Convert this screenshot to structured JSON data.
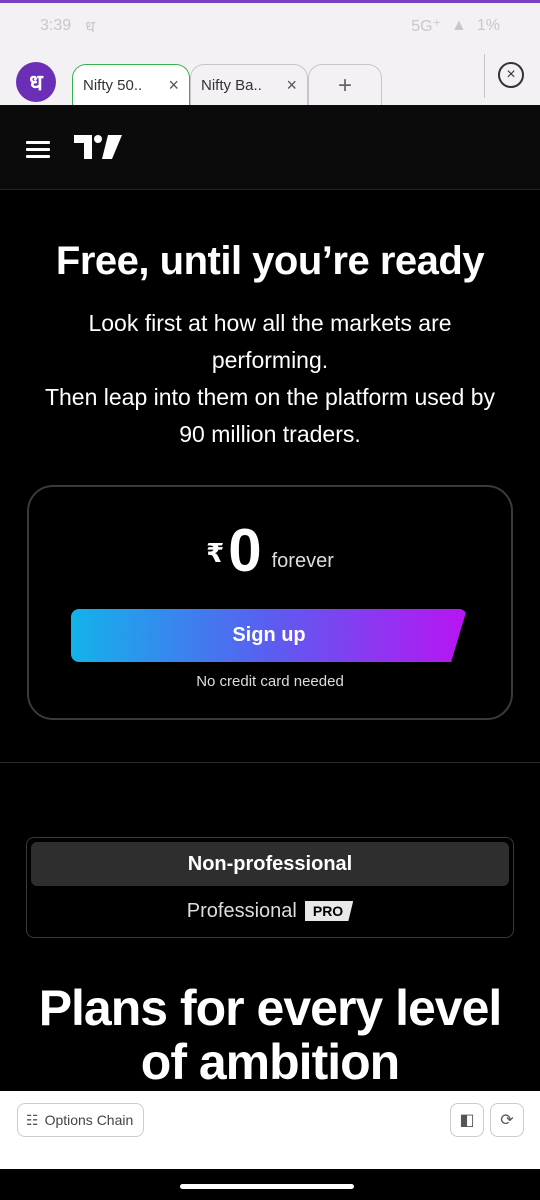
{
  "status_bar": {
    "time": "3:39",
    "left_extra": "ध",
    "network": "5G⁺",
    "battery": "1%"
  },
  "browser": {
    "logo_text": "ध",
    "tabs": [
      {
        "label": "Nifty 50..",
        "close": "×"
      },
      {
        "label": "Nifty Ba..",
        "close": "×"
      }
    ],
    "new_tab": "+",
    "close_all": "×"
  },
  "hero": {
    "title": "Free, until you’re ready",
    "line1": "Look first at how all the markets are performing.",
    "line2": "Then leap into them on the platform used by 90 million traders."
  },
  "price_card": {
    "currency": "₹",
    "amount": "0",
    "period": "forever",
    "signup_label": "Sign up",
    "note": "No credit card needed"
  },
  "plan_toggle": {
    "active_label": "Non-professional",
    "other_label": "Professional",
    "badge": "PRO"
  },
  "plans": {
    "title_line1": "Plans for every level",
    "title_line2": "of ambition"
  },
  "bottom_toolbar": {
    "chip_label": "Options Chain"
  },
  "colors": {
    "accent_purple": "#6a2fb6",
    "active_tab_border": "#36b24d",
    "gradient_start": "#12b3ea",
    "gradient_end": "#b914f2"
  }
}
